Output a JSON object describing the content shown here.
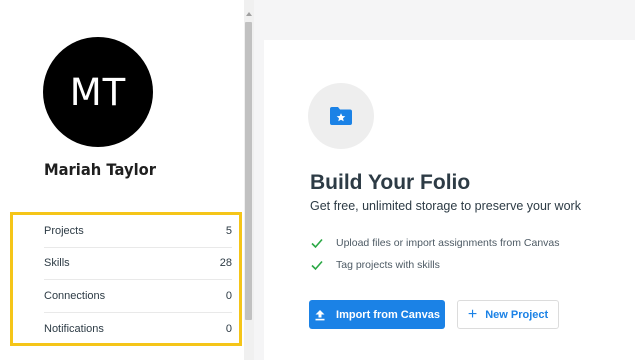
{
  "profile": {
    "initials": "MT",
    "name": "Mariah Taylor"
  },
  "stats": [
    {
      "label": "Projects",
      "value": "5"
    },
    {
      "label": "Skills",
      "value": "28"
    },
    {
      "label": "Connections",
      "value": "0"
    },
    {
      "label": "Notifications",
      "value": "0"
    }
  ],
  "main": {
    "icon": "folder-star-icon",
    "title": "Build Your Folio",
    "subtitle": "Get free, unlimited storage to preserve your work",
    "features": [
      "Upload files or import assignments from Canvas",
      "Tag projects with skills"
    ],
    "import_button": "Import from Canvas",
    "new_project_button": "New Project"
  },
  "colors": {
    "accent": "#1b82e6",
    "check": "#2aa845",
    "highlight_border": "#f5c518",
    "avatar_bg": "#000000"
  }
}
